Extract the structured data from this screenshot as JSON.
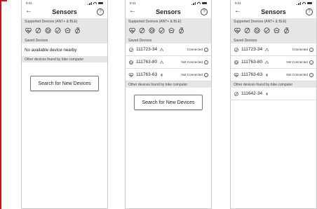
{
  "time": "9:41",
  "nav": {
    "back_glyph": "←",
    "title": "Sensors",
    "help_glyph": "?"
  },
  "sections": {
    "supported": "Supported Devices (ANT+ & BLE)",
    "saved": "Saved Devices",
    "other": "Other devices found by bike computer"
  },
  "device_type_icons": [
    "heart-rate-icon",
    "speed-sensor-icon",
    "cadence-sensor-icon",
    "speed-cadence-sensor-icon",
    "power-meter-icon",
    "smart-trainer-icon"
  ],
  "screens": [
    {
      "saved_empty_text": "No available device nearby",
      "search_button": "Search for New Devices"
    },
    {
      "saved_devices": [
        {
          "icon": "speed-cadence-sensor-icon",
          "name": "111723-34",
          "conn": "ant-icon",
          "status": "Connected"
        },
        {
          "icon": "cadence-sensor-icon",
          "name": "111763-80",
          "conn": "ant-icon",
          "status": "Not Connected"
        },
        {
          "icon": "heart-rate-icon",
          "name": "111763-63",
          "conn": "bluetooth-icon",
          "status": "Not Connected"
        }
      ],
      "search_button": "Search for New Devices"
    },
    {
      "saved_devices": [
        {
          "icon": "speed-cadence-sensor-icon",
          "name": "111723-34",
          "conn": "ant-icon",
          "status": "Connected"
        },
        {
          "icon": "cadence-sensor-icon",
          "name": "111763-80",
          "conn": "ant-icon",
          "status": "Not Connected"
        },
        {
          "icon": "heart-rate-icon",
          "name": "111763-63",
          "conn": "bluetooth-icon",
          "status": "Not Connected"
        }
      ],
      "other_devices": [
        {
          "icon": "speed-sensor-icon",
          "name": "111642-34",
          "conn": "bluetooth-icon"
        }
      ]
    }
  ],
  "colors": {
    "section_bg": "#e6e6e6",
    "frame_border": "#c9c9c9",
    "page_edge": "#c8161d"
  }
}
